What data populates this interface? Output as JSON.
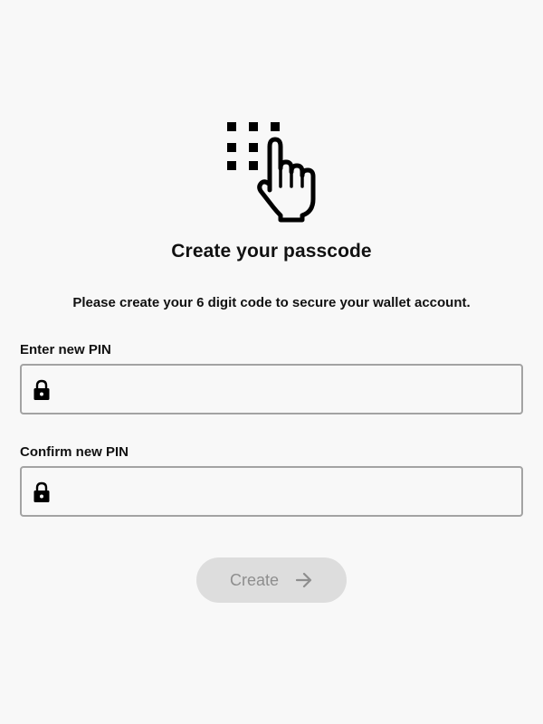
{
  "header": {
    "icon": "touch-keypad-icon",
    "title": "Create your passcode",
    "subtitle": "Please create your 6 digit code to secure your wallet account."
  },
  "form": {
    "pin": {
      "label": "Enter new PIN",
      "value": "",
      "placeholder": "",
      "icon": "lock-icon"
    },
    "confirm": {
      "label": "Confirm new PIN",
      "value": "",
      "placeholder": "",
      "icon": "lock-icon"
    }
  },
  "actions": {
    "create_label": "Create",
    "create_icon": "arrow-right-icon",
    "create_enabled": false
  },
  "colors": {
    "background": "#f8f8f8",
    "text": "#111111",
    "field_border": "#a3a3a3",
    "button_disabled_bg": "#dddddd",
    "button_disabled_text": "#8e8e8e"
  }
}
